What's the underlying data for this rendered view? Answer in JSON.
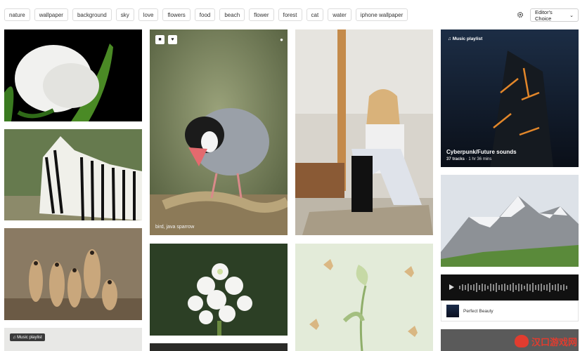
{
  "tags": [
    "nature",
    "wallpaper",
    "background",
    "sky",
    "love",
    "flowers",
    "food",
    "beach",
    "flower",
    "forest",
    "cat",
    "water",
    "iphone wallpaper"
  ],
  "toolbar": {
    "settings_icon": "gear-icon",
    "sort_label": "Editor's Choice"
  },
  "tiles": {
    "sparrow_caption": "bird, java sparrow",
    "bookmark_icon": "bookmark-icon",
    "like_icon": "heart-icon",
    "avatar_icon": "user-icon"
  },
  "playlist": {
    "label": "Music playlist",
    "title": "Cyberpunk/Future sounds",
    "tracks": "37 tracks",
    "duration": "1 hr 36 mins"
  },
  "audio": {
    "track_name": "Perfect Beauty"
  },
  "mini_playlist": {
    "label": "Music playlist"
  },
  "watermark": {
    "text": "汉口游戏网"
  },
  "colors": {
    "accent": "#e13c2f",
    "tag_border": "#dcdcdc"
  }
}
